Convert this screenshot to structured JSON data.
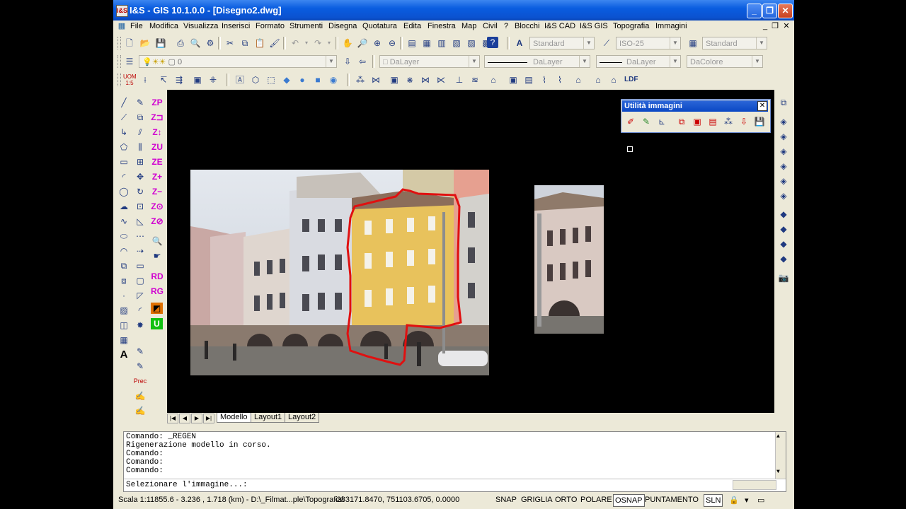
{
  "window": {
    "title": "I&S - GIS 10.1.0.0 - [Disegno2.dwg]",
    "app_icon": "I&S"
  },
  "menu": {
    "items": [
      "File",
      "Modifica",
      "Visualizza",
      "Inserisci",
      "Formato",
      "Strumenti",
      "Disegna",
      "Quotatura",
      "Edita",
      "Finestra",
      "Map",
      "Civil",
      "?",
      "Blocchi",
      "I&S CAD",
      "I&S GIS",
      "Topografia",
      "Immagini"
    ]
  },
  "toolbar": {
    "text_style": "Standard",
    "dim_style": "ISO-25",
    "table_style": "Standard",
    "layer": "0",
    "color": "DaLayer",
    "linetype": "DaLayer",
    "lineweight": "DaLayer",
    "plotstyle": "DaColore",
    "ldf_label": "LDF"
  },
  "right_toolbar": {
    "labels": [
      "ZP",
      "Z⊐",
      "Z↕",
      "ZU",
      "ZE",
      "Z+",
      "Z−",
      "Z⊙",
      "Z⊘",
      "RD",
      "RG",
      "U"
    ],
    "prec_label": "Prec"
  },
  "panel": {
    "title": "Utilità immagini"
  },
  "layout_tabs": [
    "Modello",
    "Layout1",
    "Layout2"
  ],
  "command": {
    "lines": [
      "Comando: _REGEN",
      "Rigenerazione modello in corso.",
      "Comando:",
      "Comando:",
      "Comando:"
    ],
    "prompt": "Selezionare l'immagine...:"
  },
  "status": {
    "scale": "Scala 1:11855.6 - 3.236 , 1.718 (km) - D:\\_Filmat...ple\\Topografia\\",
    "coords": "-283171.8470, 751103.6705, 0.0000",
    "toggles": [
      {
        "label": "SNAP",
        "on": false
      },
      {
        "label": "GRIGLIA",
        "on": false
      },
      {
        "label": "ORTO",
        "on": false
      },
      {
        "label": "POLARE",
        "on": false
      },
      {
        "label": "OSNAP",
        "on": true
      },
      {
        "label": "PUNTAMENTO",
        "on": false
      },
      {
        "label": "SLN",
        "on": true
      }
    ]
  },
  "colors": {
    "title_bar": "#0a5de0",
    "outline_red": "#e01010",
    "canvas": "#000000"
  }
}
